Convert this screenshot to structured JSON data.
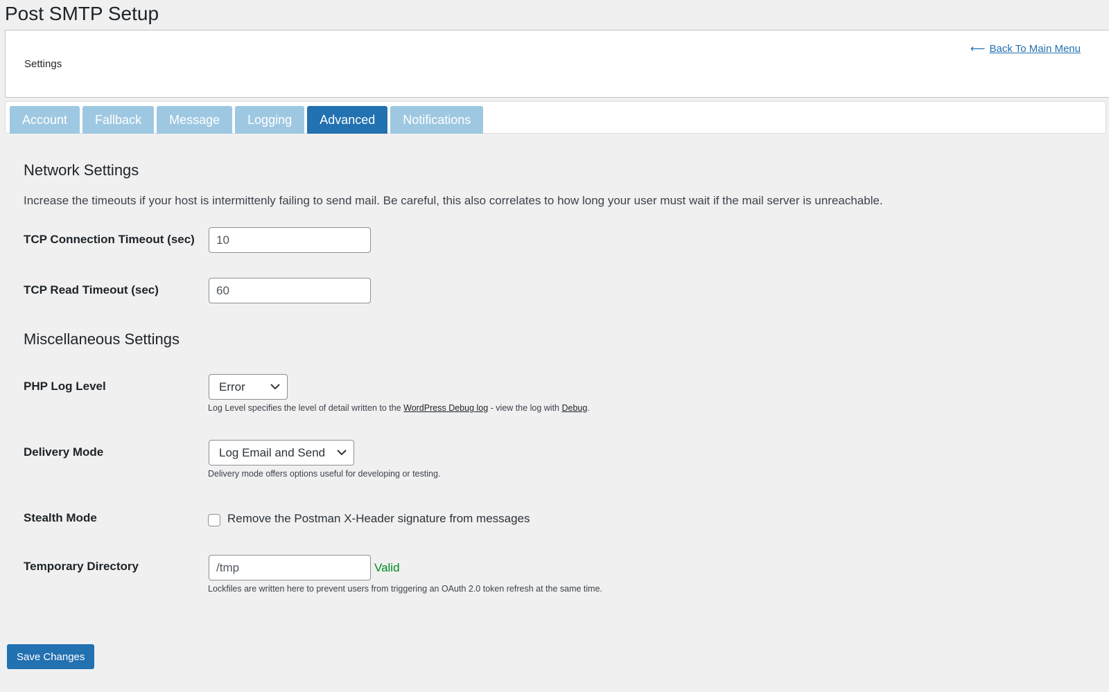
{
  "page": {
    "title": "Post SMTP Setup"
  },
  "header": {
    "label": "Settings",
    "back_link": "Back To Main Menu"
  },
  "tabs": [
    {
      "label": "Account",
      "active": false
    },
    {
      "label": "Fallback",
      "active": false
    },
    {
      "label": "Message",
      "active": false
    },
    {
      "label": "Logging",
      "active": false
    },
    {
      "label": "Advanced",
      "active": true
    },
    {
      "label": "Notifications",
      "active": false
    }
  ],
  "network": {
    "title": "Network Settings",
    "description": "Increase the timeouts if your host is intermittenly failing to send mail. Be careful, this also correlates to how long your user must wait if the mail server is unreachable.",
    "tcp_connection": {
      "label": "TCP Connection Timeout (sec)",
      "value": "10"
    },
    "tcp_read": {
      "label": "TCP Read Timeout (sec)",
      "value": "60"
    }
  },
  "misc": {
    "title": "Miscellaneous Settings",
    "php_log": {
      "label": "PHP Log Level",
      "value": "Error",
      "help_prefix": "Log Level specifies the level of detail written to the ",
      "help_link1": "WordPress Debug log",
      "help_middle": " - view the log with ",
      "help_link2": "Debug",
      "help_suffix": "."
    },
    "delivery": {
      "label": "Delivery Mode",
      "value": "Log Email and Send",
      "help": "Delivery mode offers options useful for developing or testing."
    },
    "stealth": {
      "label": "Stealth Mode",
      "checkbox_label": "Remove the Postman X-Header signature from messages",
      "checked": false
    },
    "temp_dir": {
      "label": "Temporary Directory",
      "value": "/tmp",
      "status": "Valid",
      "help": "Lockfiles are written here to prevent users from triggering an OAuth 2.0 token refresh at the same time."
    }
  },
  "footer": {
    "save_label": "Save Changes"
  },
  "colors": {
    "primary": "#2271b1",
    "tab_inactive": "#9ec8e1",
    "valid": "#008a20",
    "background": "#f0f0f1"
  },
  "icons": {
    "back": "arrow-left-icon",
    "dropdown": "chevron-down-icon"
  }
}
